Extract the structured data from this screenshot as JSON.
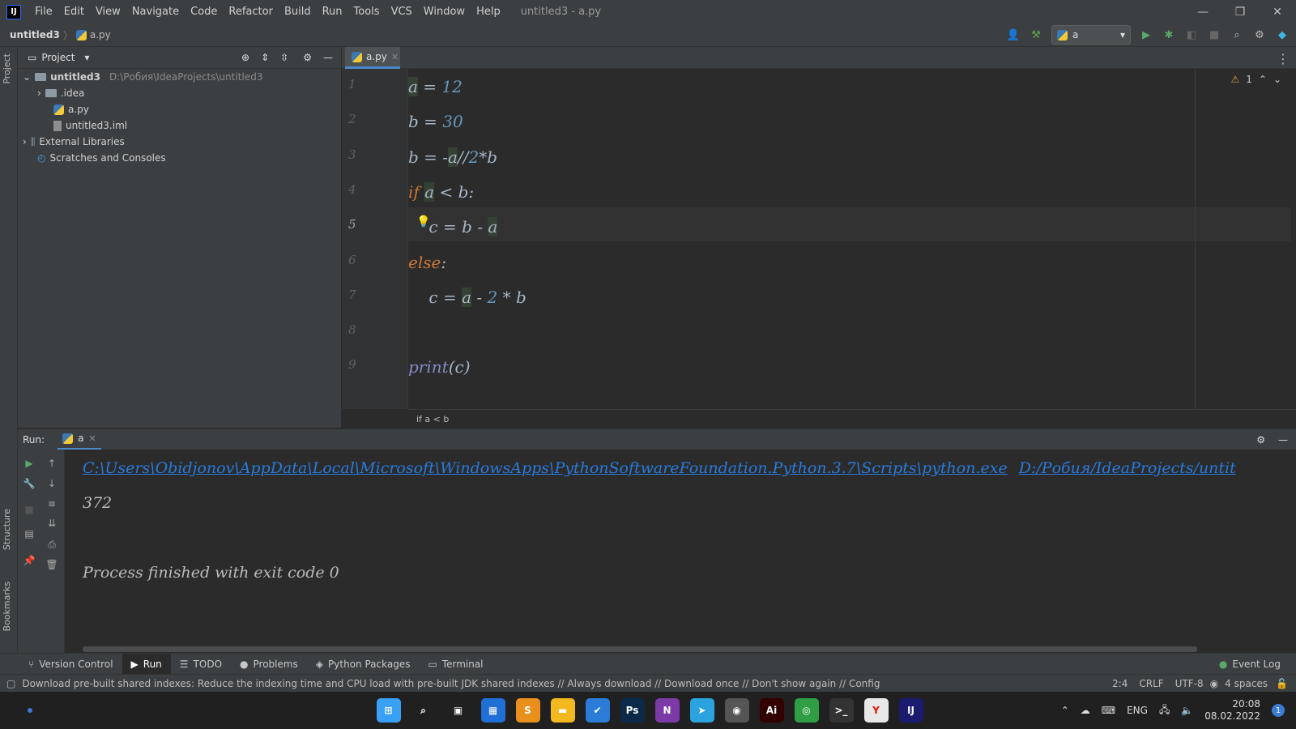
{
  "window": {
    "title": "untitled3 - a.py",
    "menu": [
      "File",
      "Edit",
      "View",
      "Navigate",
      "Code",
      "Refactor",
      "Build",
      "Run",
      "Tools",
      "VCS",
      "Window",
      "Help"
    ],
    "controls": [
      "—",
      "❐",
      "✕"
    ]
  },
  "breadcrumb": {
    "project": "untitled3",
    "file": "a.py"
  },
  "run_config": "a",
  "stripe": {
    "project": "Project",
    "structure": "Structure",
    "bookmarks": "Bookmarks"
  },
  "project_panel": {
    "title": "Project",
    "tree": [
      {
        "label": "untitled3",
        "path": "D:\\Робия\\IdeaProjects\\untitled3"
      },
      {
        "label": ".idea"
      },
      {
        "label": "a.py"
      },
      {
        "label": "untitled3.iml"
      },
      {
        "label": "External Libraries"
      },
      {
        "label": "Scratches and Consoles"
      }
    ]
  },
  "editor": {
    "tab": "a.py",
    "inspection_count": "1",
    "line_numbers": [
      "1",
      "2",
      "3",
      "4",
      "5",
      "6",
      "7",
      "8",
      "9"
    ],
    "lines": [
      {
        "t": [
          {
            "s": "a",
            "c": "hl"
          },
          {
            "s": " = ",
            "c": ""
          },
          {
            "s": "12",
            "c": "num"
          }
        ]
      },
      {
        "t": [
          {
            "s": "b = ",
            "c": ""
          },
          {
            "s": "30",
            "c": "num"
          }
        ]
      },
      {
        "t": [
          {
            "s": "b = -",
            "c": ""
          },
          {
            "s": "a",
            "c": "hl"
          },
          {
            "s": "//",
            "c": ""
          },
          {
            "s": "2",
            "c": "num"
          },
          {
            "s": "*b",
            "c": ""
          }
        ]
      },
      {
        "t": [
          {
            "s": "if ",
            "c": "kw"
          },
          {
            "s": "a",
            "c": "hl"
          },
          {
            "s": " < b:",
            "c": ""
          }
        ]
      },
      {
        "t": [
          {
            "s": "    c = b - ",
            "c": ""
          },
          {
            "s": "a",
            "c": "hl"
          }
        ]
      },
      {
        "t": [
          {
            "s": "else",
            "c": "kw"
          },
          {
            "s": ":",
            "c": ""
          }
        ]
      },
      {
        "t": [
          {
            "s": "    c = ",
            "c": ""
          },
          {
            "s": "a",
            "c": "hl"
          },
          {
            "s": " - ",
            "c": ""
          },
          {
            "s": "2",
            "c": "num"
          },
          {
            "s": " * b",
            "c": ""
          }
        ]
      },
      {
        "t": []
      },
      {
        "t": [
          {
            "s": "print",
            "c": "fn"
          },
          {
            "s": "(c)",
            "c": ""
          }
        ]
      }
    ],
    "breadcrumb_status": "if a < b"
  },
  "run": {
    "label": "Run:",
    "tab": "a",
    "cmd_link": "C:\\Users\\Obidjonov\\AppData\\Local\\Microsoft\\WindowsApps\\PythonSoftwareFoundation.Python.3.7\\Scripts\\python.exe",
    "script_link": "D:/Робия/IdeaProjects/untit",
    "output": "372",
    "finish": "Process finished with exit code 0"
  },
  "tool_tabs": [
    "Version Control",
    "Run",
    "TODO",
    "Problems",
    "Python Packages",
    "Terminal"
  ],
  "event_log": "Event Log",
  "status": {
    "message": "Download pre-built shared indexes: Reduce the indexing time and CPU load with pre-built JDK shared indexes // Always download // Download once // Don't show again // Configure... (moments ago)",
    "position": "2:4",
    "line_sep": "CRLF",
    "encoding": "UTF-8",
    "indent": "4 spaces"
  },
  "taskbar": {
    "apps": [
      {
        "name": "windows-start",
        "glyph": "⊞",
        "color": "#3aa0f5"
      },
      {
        "name": "search",
        "glyph": "⌕",
        "color": "#202020"
      },
      {
        "name": "task-view",
        "glyph": "▣",
        "color": "#202020"
      },
      {
        "name": "widgets",
        "glyph": "▦",
        "color": "#1f6fd6"
      },
      {
        "name": "sublime",
        "glyph": "S",
        "color": "#e8901b"
      },
      {
        "name": "explorer",
        "glyph": "▬",
        "color": "#f2b81d"
      },
      {
        "name": "todo",
        "glyph": "✔",
        "color": "#2a7cd6"
      },
      {
        "name": "photoshop",
        "glyph": "Ps",
        "color": "#0b2a4a"
      },
      {
        "name": "onenote",
        "glyph": "N",
        "color": "#7b3aa5"
      },
      {
        "name": "telegram",
        "glyph": "➤",
        "color": "#2aa3de"
      },
      {
        "name": "media",
        "glyph": "◉",
        "color": "#555555"
      },
      {
        "name": "illustrator",
        "glyph": "Ai",
        "color": "#330000"
      },
      {
        "name": "chrome",
        "glyph": "◎",
        "color": "#2f9e44"
      },
      {
        "name": "cmd",
        "glyph": ">_",
        "color": "#333333"
      },
      {
        "name": "yandex",
        "glyph": "Y",
        "color": "#e8e8e8"
      },
      {
        "name": "intellij",
        "glyph": "IJ",
        "color": "#1a1a6e"
      }
    ],
    "lang": "ENG",
    "time": "20:08",
    "date": "08.02.2022",
    "notif": "1"
  }
}
